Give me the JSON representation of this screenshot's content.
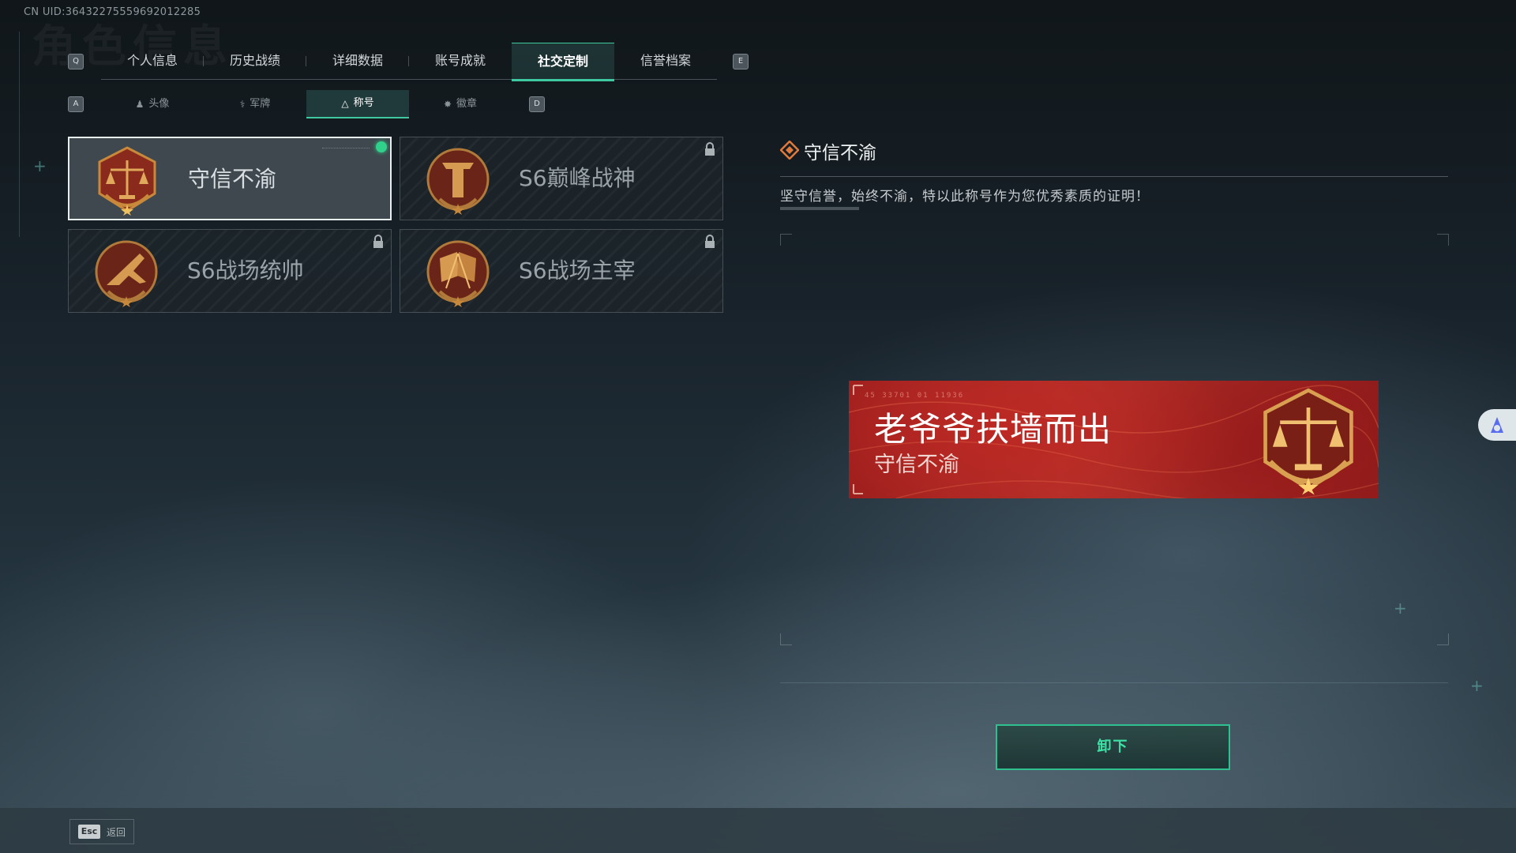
{
  "uid_text": "CN UID:3643227555969201​2285",
  "page_title_ghost": "角色信息",
  "main_tabs": {
    "left_key": "Q",
    "right_key": "E",
    "items": [
      {
        "label": "个人信息",
        "active": false
      },
      {
        "label": "历史战绩",
        "active": false
      },
      {
        "label": "详细数据",
        "active": false
      },
      {
        "label": "账号成就",
        "active": false
      },
      {
        "label": "社交定制",
        "active": true
      },
      {
        "label": "信誉档案",
        "active": false
      }
    ]
  },
  "sub_tabs": {
    "left_key": "A",
    "right_key": "D",
    "items": [
      {
        "label": "头像",
        "icon": "person-icon",
        "active": false
      },
      {
        "label": "军牌",
        "icon": "dogtag-icon",
        "active": false
      },
      {
        "label": "称号",
        "icon": "title-icon",
        "active": true
      },
      {
        "label": "徽章",
        "icon": "badge-icon",
        "active": false
      }
    ]
  },
  "titles": [
    {
      "name": "守信不渝",
      "medal": "scales-medal-icon",
      "selected": true,
      "equipped": true,
      "locked": false
    },
    {
      "name": "S6巅峰战神",
      "medal": "pillar-medal-icon",
      "selected": false,
      "equipped": false,
      "locked": true
    },
    {
      "name": "S6战场统帅",
      "medal": "jet-medal-icon",
      "selected": false,
      "equipped": false,
      "locked": true
    },
    {
      "name": "S6战场主宰",
      "medal": "flags-medal-icon",
      "selected": false,
      "equipped": false,
      "locked": true
    }
  ],
  "detail": {
    "title": "守信不渝",
    "description": "坚守信誉，始终不渝，特以此称号作为您优秀素质的证明！"
  },
  "banner": {
    "player_name": "老爷爷扶墙而出",
    "title": "守信不渝",
    "code_text": "45 33701  01 11936"
  },
  "actions": {
    "unequip_label": "卸下"
  },
  "footer": {
    "esc_key": "Esc",
    "back_label": "返回"
  },
  "colors": {
    "accent": "#3ec9a0",
    "equipped_dot": "#30d18a",
    "banner_red": "#9a1e1d",
    "medal_gold": "#c9893a"
  }
}
